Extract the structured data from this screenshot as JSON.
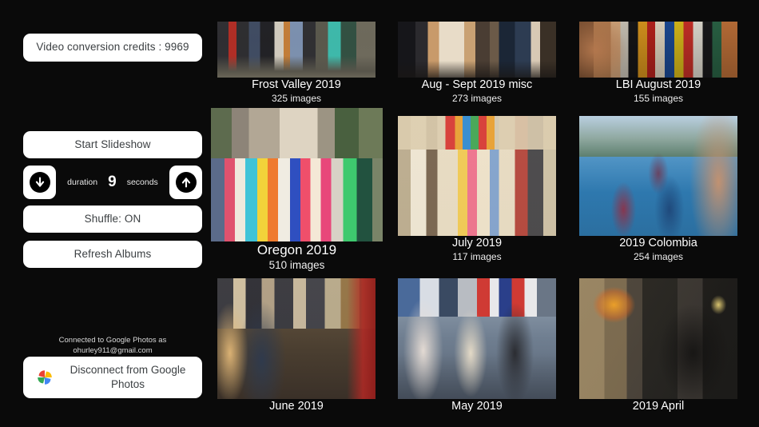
{
  "sidebar": {
    "credits_label": "Video conversion credits : 9969",
    "start_slideshow_label": "Start Slideshow",
    "duration": {
      "prefix_label": "duration",
      "value": "9",
      "suffix_label": "seconds",
      "decrease_icon": "arrow-down-circle-icon",
      "increase_icon": "arrow-up-circle-icon"
    },
    "shuffle_label": "Shuffle: ON",
    "refresh_label": "Refresh Albums",
    "connection": {
      "status_line1": "Connected to Google Photos as",
      "status_line2": "ohurley911@gmail.com",
      "disconnect_label": "Disconnect from Google Photos",
      "logo_icon": "google-photos-pinwheel-icon"
    }
  },
  "albums": [
    {
      "title": "Frost Valley 2019",
      "count": "325 images",
      "art": "ph-frostvalley"
    },
    {
      "title": "Aug - Sept 2019 misc",
      "count": "273 images",
      "art": "ph-augsept"
    },
    {
      "title": "LBI August 2019",
      "count": "155 images",
      "art": "ph-lbi"
    },
    {
      "title": "Oregon 2019",
      "count": "510 images",
      "art": "ph-oregon"
    },
    {
      "title": "July 2019",
      "count": "117 images",
      "art": "ph-july"
    },
    {
      "title": "2019 Colombia",
      "count": "254 images",
      "art": "ph-colombia"
    },
    {
      "title": "June 2019",
      "count": "",
      "art": "ph-june"
    },
    {
      "title": "May 2019",
      "count": "",
      "art": "ph-may"
    },
    {
      "title": "2019 April",
      "count": "",
      "art": "ph-april"
    }
  ],
  "colors": {
    "background": "#0a0a0a",
    "button_surface": "#ffffff",
    "button_text": "#3c4043",
    "caption_text": "#ffffff"
  }
}
